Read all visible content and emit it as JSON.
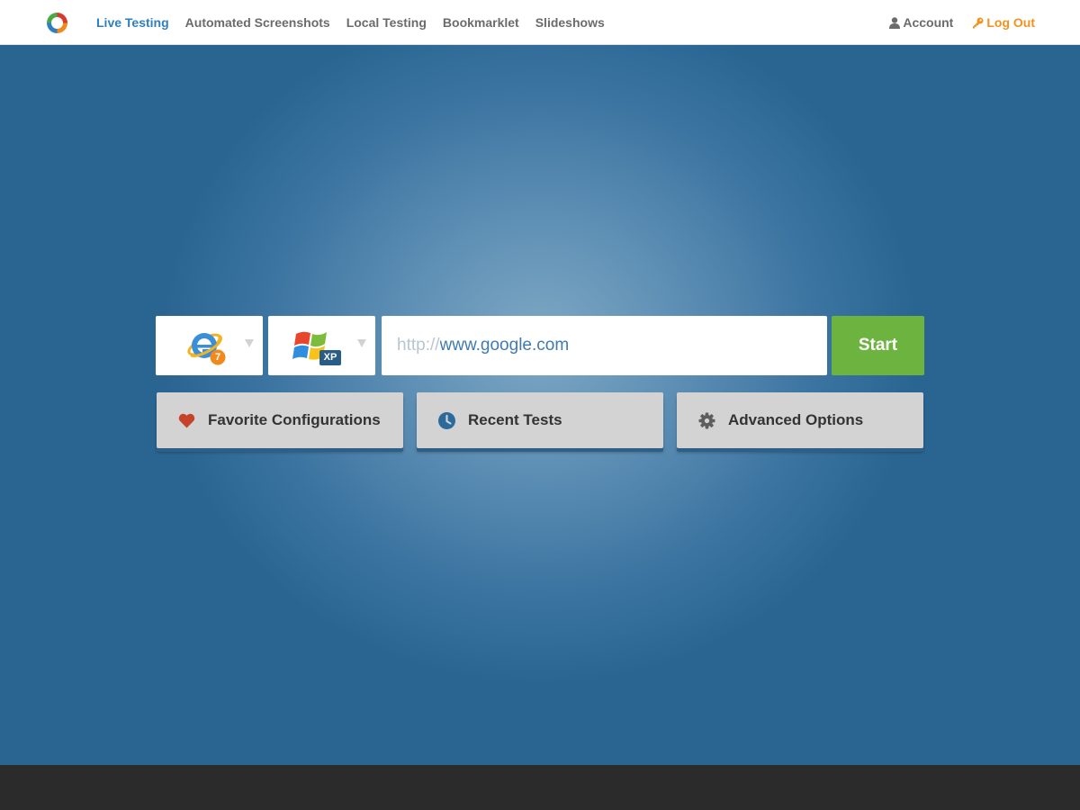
{
  "nav": {
    "items": [
      {
        "label": "Live Testing",
        "active": true
      },
      {
        "label": "Automated Screenshots",
        "active": false
      },
      {
        "label": "Local Testing",
        "active": false
      },
      {
        "label": "Bookmarklet",
        "active": false
      },
      {
        "label": "Slideshows",
        "active": false
      }
    ],
    "account_label": "Account",
    "logout_label": "Log Out",
    "account_icon": "user-icon",
    "logout_icon": "key-icon"
  },
  "launcher": {
    "browser": {
      "icon": "internet-explorer-icon",
      "version_badge": "7"
    },
    "os": {
      "icon": "windows-flag-icon",
      "version_badge": "XP"
    },
    "url_prefix": "http://",
    "url_value": "www.google.com",
    "start_label": "Start"
  },
  "actions": [
    {
      "label": "Favorite Configurations",
      "icon": "heart-icon"
    },
    {
      "label": "Recent Tests",
      "icon": "clock-icon"
    },
    {
      "label": "Advanced Options",
      "icon": "gear-icon"
    }
  ],
  "colors": {
    "accent": "#2f7fbf",
    "logout": "#f0921e",
    "start": "#6db33f",
    "heart": "#c6432b",
    "clock": "#2d6a9c"
  }
}
